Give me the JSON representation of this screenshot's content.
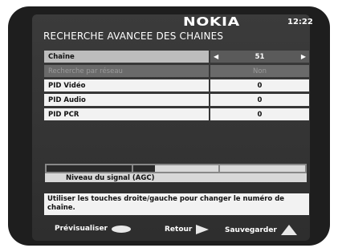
{
  "header": {
    "brand": "NOKIA",
    "clock": "12:22",
    "title": "RECHERCHE AVANCEE DES CHAINES"
  },
  "settings": [
    {
      "label": "Chaîne",
      "value": "51",
      "state": "selected"
    },
    {
      "label": "Recherche par réseau",
      "value": "Non",
      "state": "disabled"
    },
    {
      "label": "PID Vidéo",
      "value": "0",
      "state": "normal"
    },
    {
      "label": "PID Audio",
      "value": "0",
      "state": "normal"
    },
    {
      "label": "PID PCR",
      "value": "0",
      "state": "normal"
    }
  ],
  "signal": {
    "label": "Niveau du signal (AGC)",
    "level": 0.42
  },
  "help_text": "Utiliser les touches droite/gauche pour changer le numéro de chaîne.",
  "footer": {
    "preview_label": "Prévisualiser",
    "back_label": "Retour",
    "save_label": "Sauvegarder"
  },
  "colors": {
    "screen_bg": "#333333",
    "selected_value_bg": "#5a5a5a",
    "row_bg": "#f2f2f2"
  }
}
